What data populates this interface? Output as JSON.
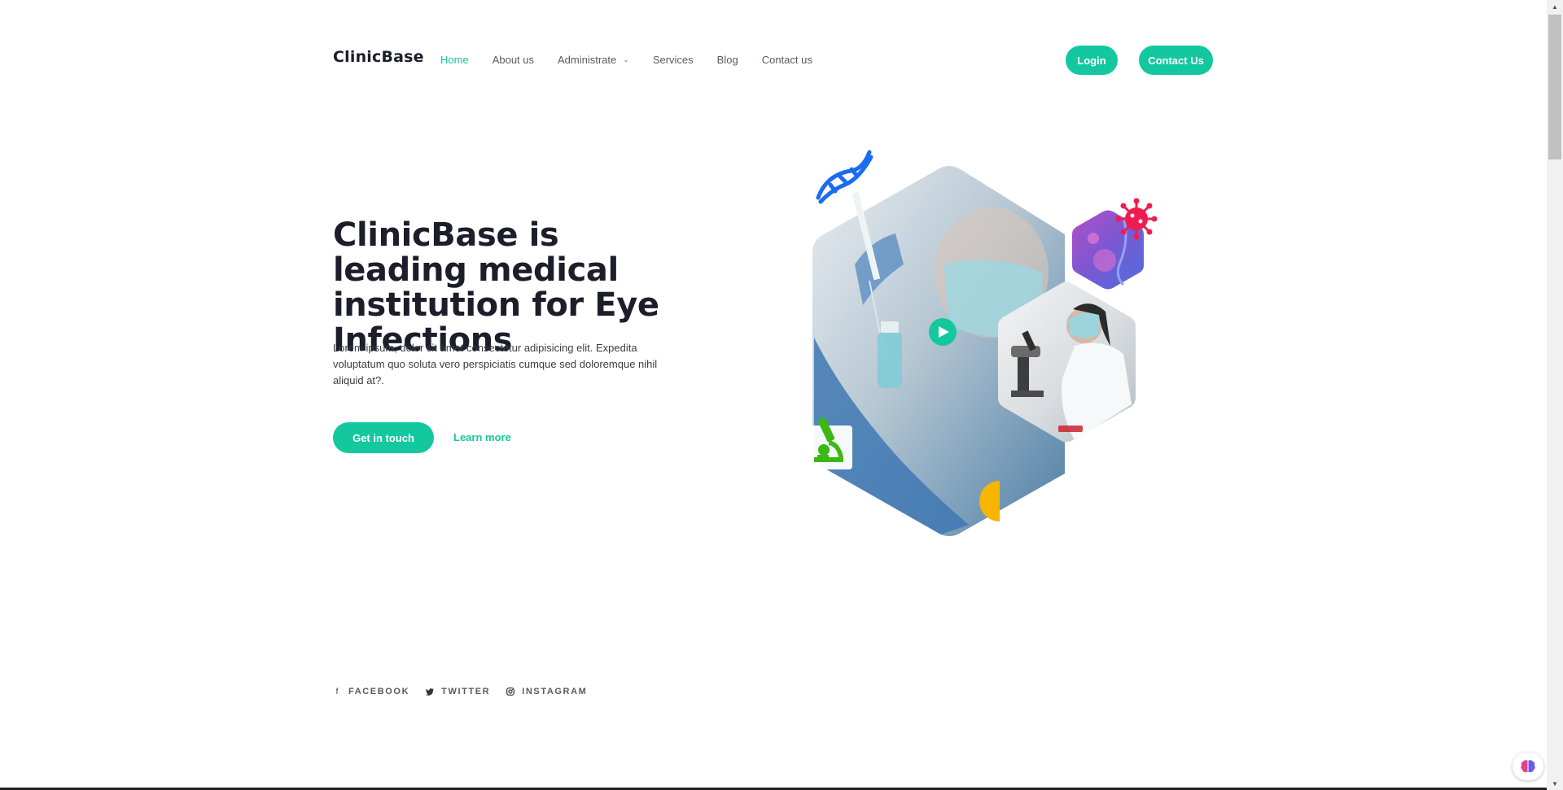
{
  "brand": {
    "name": "ClinicBase"
  },
  "nav": {
    "items": [
      {
        "label": "Home",
        "active": true
      },
      {
        "label": "About us"
      },
      {
        "label": "Administrate",
        "has_dropdown": true
      },
      {
        "label": "Services"
      },
      {
        "label": "Blog"
      },
      {
        "label": "Contact us"
      }
    ]
  },
  "header": {
    "login_label": "Login",
    "contact_label": "Contact Us"
  },
  "hero": {
    "title": "ClinicBase is leading medical institution for Eye Infections",
    "description": "Lorem ipsum, dolor sit amet consectetur adipisicing elit. Expedita voluptatum quo soluta vero perspiciatis cumque sed doloremque nihil aliquid at?.",
    "primary_cta": "Get in touch",
    "secondary_cta": "Learn more"
  },
  "social": [
    {
      "label": "FACEBOOK",
      "icon": "facebook-icon"
    },
    {
      "label": "TWITTER",
      "icon": "twitter-icon"
    },
    {
      "label": "INSTAGRAM",
      "icon": "instagram-icon"
    }
  ],
  "colors": {
    "accent": "#13c89e",
    "dna": "#1a6cf0",
    "virus": "#ef1d4f",
    "microscope": "#3cb815",
    "half_circle": "#f7b500",
    "heading": "#1d1d2b"
  }
}
